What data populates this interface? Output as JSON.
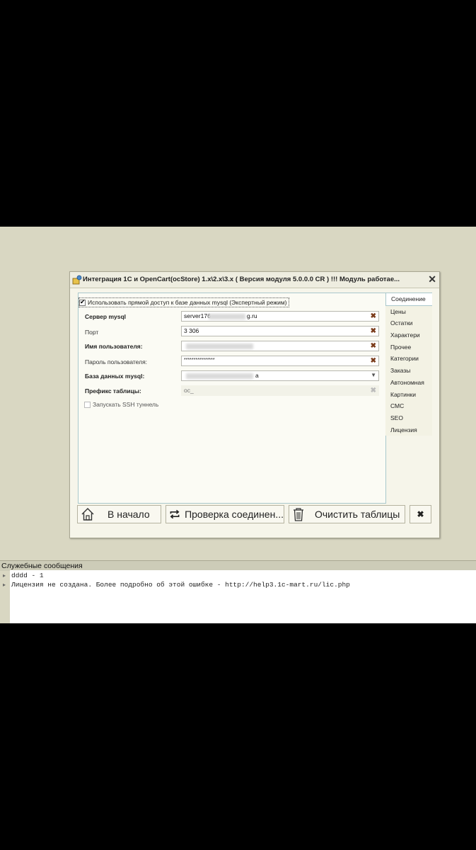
{
  "window": {
    "title": "Интеграция 1С и OpenCart(ocStore) 1.x\\2.x\\3.x ( Версия модуля 5.0.0.0 CR ) !!! Модуль работае..."
  },
  "form": {
    "direct_access_label": "Использовать прямой доступ к базе данных mysql (Экспертный режим)",
    "direct_access_checked": true,
    "server_label": "Сервер mysql",
    "server_value_start": "server176",
    "server_value_end": "g.ru",
    "port_label": "Порт",
    "port_value": "3 306",
    "user_label": "Имя пользователя:",
    "password_label": "Пароль пользователя:",
    "password_value": "****************",
    "database_label": "База данных mysql:",
    "database_value_end": "a",
    "prefix_label": "Префикс таблицы:",
    "prefix_value": "oc_",
    "ssh_label": "Запускать SSH туннель",
    "ssh_checked": false
  },
  "tabs": [
    {
      "label": "Соединение",
      "active": true
    },
    {
      "label": "Цены",
      "active": false
    },
    {
      "label": "Остатки",
      "active": false
    },
    {
      "label": "Характери",
      "active": false
    },
    {
      "label": "Прочее",
      "active": false
    },
    {
      "label": "Категории",
      "active": false
    },
    {
      "label": "Заказы",
      "active": false
    },
    {
      "label": "Автономная",
      "active": false
    },
    {
      "label": "Картинки",
      "active": false
    },
    {
      "label": "СМС",
      "active": false
    },
    {
      "label": "SEO",
      "active": false
    },
    {
      "label": "Лицензия",
      "active": false
    }
  ],
  "buttons": {
    "home": "В начало",
    "check": "Проверка соединен...",
    "clear": "Очистить таблицы",
    "close": "✖"
  },
  "messages": {
    "title": "Служебные сообщения",
    "lines": [
      "dddd - 1",
      "Лицензия не создана. Более подробно об этой ошибке - http://help3.1c-mart.ru/lic.php"
    ]
  }
}
